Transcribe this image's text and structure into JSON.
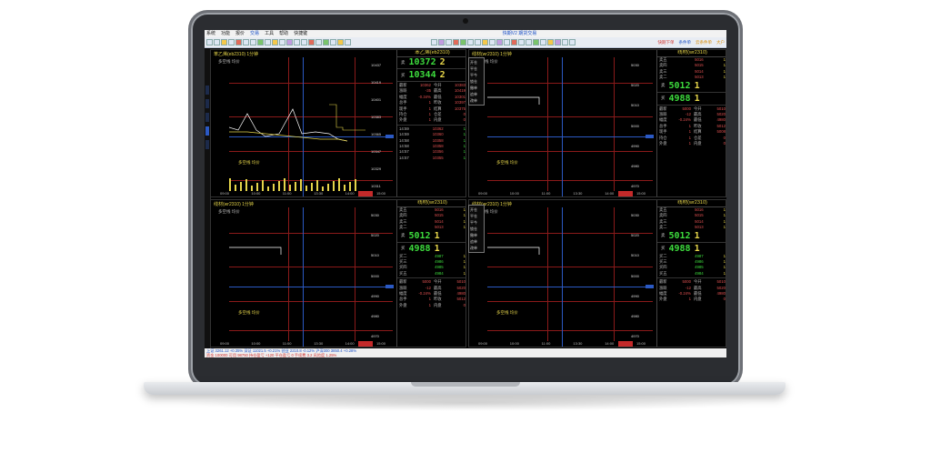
{
  "app": {
    "title": "快期V2 期货交易",
    "menu": [
      "系统",
      "功能",
      "报价",
      "交易",
      "工具",
      "帮助",
      "快捷键"
    ],
    "toolbar_right": [
      "快期下单",
      "条件单",
      "云条件单",
      "大户"
    ]
  },
  "panels": {
    "top_left": {
      "title": "苯乙烯(eb2310) 1分钟",
      "context": "多空线 均价",
      "quote_title": "苯乙烯(eb2310)",
      "sell_price": "10372",
      "sell_qty": "2",
      "buy_price": "10344",
      "buy_qty": "2",
      "rows": [
        {
          "k": "最新",
          "v": "10362",
          "k2": "今开",
          "v2": "10383"
        },
        {
          "k": "涨跌",
          "v": "-35",
          "k2": "最高",
          "v2": "10419"
        },
        {
          "k": "幅度",
          "v": "-0.34%",
          "k2": "最低",
          "v2": "10301"
        },
        {
          "k": "总手",
          "v": "1",
          "k2": "昨收",
          "v2": "10397"
        },
        {
          "k": "现手",
          "v": "1",
          "k2": "结算",
          "v2": "10375"
        },
        {
          "k": "持仓",
          "v": "1",
          "k2": "仓差",
          "v2": "0"
        },
        {
          "k": "外盘",
          "v": "1",
          "k2": "内盘",
          "v2": "0"
        }
      ],
      "ticks": [
        {
          "t": "14:59",
          "p": "10362",
          "q": "1"
        },
        {
          "t": "14:59",
          "p": "10360",
          "q": "1"
        },
        {
          "t": "14:58",
          "p": "10358",
          "q": "1"
        },
        {
          "t": "14:58",
          "p": "10358",
          "q": "1"
        },
        {
          "t": "14:57",
          "p": "10356",
          "q": "1"
        },
        {
          "t": "14:57",
          "p": "10355",
          "q": "1"
        }
      ],
      "yticks": [
        "10437",
        "10419",
        "10401",
        "10383",
        "10365",
        "10347",
        "10329",
        "10311"
      ],
      "xticks": [
        "09:00",
        "10:00",
        "11:00",
        "13:30",
        "14:00",
        "15:00"
      ]
    },
    "top_right": {
      "title": "线材(wr2310) 1分钟",
      "context": "多空线 均价",
      "quote_title": "线材(wr2310)",
      "levels": [
        {
          "k": "卖五",
          "v": "5016",
          "n": "1"
        },
        {
          "k": "卖四",
          "v": "5015",
          "n": "1"
        },
        {
          "k": "卖三",
          "v": "5014",
          "n": "1"
        },
        {
          "k": "卖二",
          "v": "5013",
          "n": "1"
        }
      ],
      "sell_price": "5012",
      "sell_qty": "1",
      "buy_price": "4988",
      "buy_qty": "1",
      "rows": [
        {
          "k": "最新",
          "v": "5000",
          "k2": "今开",
          "v2": "5010"
        },
        {
          "k": "涨跌",
          "v": "-12",
          "k2": "最高",
          "v2": "5020"
        },
        {
          "k": "幅度",
          "v": "-0.24%",
          "k2": "最低",
          "v2": "4980"
        },
        {
          "k": "总手",
          "v": "1",
          "k2": "昨收",
          "v2": "5012"
        },
        {
          "k": "现手",
          "v": "1",
          "k2": "结算",
          "v2": "5008"
        },
        {
          "k": "持仓",
          "v": "1",
          "k2": "仓差",
          "v2": "0"
        },
        {
          "k": "外盘",
          "v": "1",
          "k2": "内盘",
          "v2": "0"
        }
      ],
      "yticks": [
        "5030",
        "5020",
        "5010",
        "5000",
        "4990",
        "4980",
        "4970"
      ],
      "xticks": [
        "09:00",
        "10:00",
        "11:00",
        "13:30",
        "14:00",
        "15:00"
      ]
    },
    "bottom_left": {
      "title": "线材(wr2310) 1分钟",
      "context": "多空线 均价",
      "quote_title": "线材(wr2310)",
      "levels": [
        {
          "k": "卖五",
          "v": "5016",
          "n": "1"
        },
        {
          "k": "卖四",
          "v": "5015",
          "n": "1"
        },
        {
          "k": "卖三",
          "v": "5014",
          "n": "1"
        },
        {
          "k": "卖二",
          "v": "5013",
          "n": "1"
        }
      ],
      "sell_price": "5012",
      "sell_qty": "1",
      "buy_price": "4988",
      "buy_qty": "1",
      "levels_buy": [
        {
          "k": "买二",
          "v": "4987",
          "n": "1"
        },
        {
          "k": "买三",
          "v": "4986",
          "n": "1"
        },
        {
          "k": "买四",
          "v": "4985",
          "n": "1"
        },
        {
          "k": "买五",
          "v": "4984",
          "n": "1"
        }
      ],
      "rows": [
        {
          "k": "最新",
          "v": "5000",
          "k2": "今开",
          "v2": "5010"
        },
        {
          "k": "涨跌",
          "v": "-12",
          "k2": "最高",
          "v2": "5020"
        },
        {
          "k": "幅度",
          "v": "-0.24%",
          "k2": "最低",
          "v2": "4980"
        },
        {
          "k": "总手",
          "v": "1",
          "k2": "昨收",
          "v2": "5012"
        },
        {
          "k": "外盘",
          "v": "1",
          "k2": "内盘",
          "v2": "0"
        }
      ],
      "yticks": [
        "5030",
        "5020",
        "5010",
        "5000",
        "4990",
        "4980",
        "4970"
      ],
      "xticks": [
        "09:00",
        "10:00",
        "11:00",
        "13:30",
        "14:00",
        "15:00"
      ]
    },
    "bottom_right": {
      "title": "线材(wr2310) 1分钟",
      "context": "多空线 均价",
      "quote_title": "线材(wr2310)",
      "levels": [
        {
          "k": "卖五",
          "v": "5016",
          "n": "1"
        },
        {
          "k": "卖四",
          "v": "5015",
          "n": "1"
        },
        {
          "k": "卖三",
          "v": "5014",
          "n": "1"
        },
        {
          "k": "卖二",
          "v": "5013",
          "n": "1"
        }
      ],
      "sell_price": "5012",
      "sell_qty": "1",
      "buy_price": "4988",
      "buy_qty": "1",
      "levels_buy": [
        {
          "k": "买二",
          "v": "4987",
          "n": "1"
        },
        {
          "k": "买三",
          "v": "4986",
          "n": "1"
        },
        {
          "k": "买四",
          "v": "4985",
          "n": "1"
        },
        {
          "k": "买五",
          "v": "4984",
          "n": "1"
        }
      ],
      "rows": [
        {
          "k": "最新",
          "v": "5000",
          "k2": "今开",
          "v2": "5010"
        },
        {
          "k": "涨跌",
          "v": "-12",
          "k2": "最高",
          "v2": "5020"
        },
        {
          "k": "幅度",
          "v": "-0.24%",
          "k2": "最低",
          "v2": "4980"
        },
        {
          "k": "外盘",
          "v": "1",
          "k2": "内盘",
          "v2": "0"
        }
      ],
      "yticks": [
        "5030",
        "5020",
        "5010",
        "5000",
        "4990",
        "4980",
        "4970"
      ],
      "xticks": [
        "09:00",
        "10:00",
        "11:00",
        "13:30",
        "14:00",
        "15:00"
      ]
    }
  },
  "popup_items": [
    "开仓",
    "平仓",
    "平今",
    "锁仓",
    "撤单",
    "追单",
    "改单"
  ],
  "status": {
    "line1": "上证 3261.12 +0.35%  深证 11021.5 +0.21%  创业 2210.8 -0.12%  沪深300 3850.4 +0.28%",
    "line2": "资金 100000  可用 98750  持仓盈亏 +120  平仓盈亏 0  手续费 3.2  风险度 1.25%"
  },
  "colors": {
    "up": "#e05050",
    "down": "#3ddc3d",
    "title": "#e6d54a",
    "crosshair": "#2b59c3",
    "grid": "#8b1a1a"
  }
}
